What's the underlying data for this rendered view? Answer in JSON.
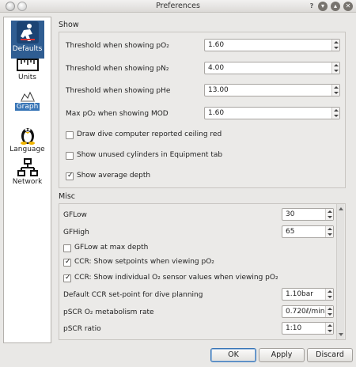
{
  "window": {
    "title": "Preferences"
  },
  "sidebar": {
    "items": [
      {
        "label": "Defaults",
        "icon": "diver-icon"
      },
      {
        "label": "Units",
        "icon": "ruler-icon"
      },
      {
        "label": "Graph",
        "icon": "graph-icon"
      },
      {
        "label": "Language",
        "icon": "penguin-icon"
      },
      {
        "label": "Network",
        "icon": "network-icon"
      }
    ],
    "selected": "Graph"
  },
  "show": {
    "title": "Show",
    "threshold_po2_label": "Threshold when showing pO₂",
    "threshold_po2_value": "1.60",
    "threshold_pn2_label": "Threshold when showing pN₂",
    "threshold_pn2_value": "4.00",
    "threshold_phe_label": "Threshold when showing pHe",
    "threshold_phe_value": "13.00",
    "max_po2_label": "Max pO₂ when showing MOD",
    "max_po2_value": "1.60",
    "draw_ceiling_label": "Draw dive computer reported ceiling red",
    "draw_ceiling_checked": false,
    "show_unused_label": "Show unused cylinders in Equipment tab",
    "show_unused_checked": false,
    "show_avg_depth_label": "Show average depth",
    "show_avg_depth_checked": true
  },
  "misc": {
    "title": "Misc",
    "gflow_label": "GFLow",
    "gflow_value": "30",
    "gfhigh_label": "GFHigh",
    "gfhigh_value": "65",
    "gflow_max_label": "GFLow at max depth",
    "gflow_max_checked": false,
    "ccr_setpoints_label": "CCR: Show setpoints when viewing pO₂",
    "ccr_setpoints_checked": true,
    "ccr_sensor_label": "CCR: Show individual O₂ sensor values when viewing pO₂",
    "ccr_sensor_checked": true,
    "ccr_setpoint_label": "Default CCR set-point for dive planning",
    "ccr_setpoint_value": "1.10bar",
    "pscr_metabolism_label": "pSCR O₂ metabolism rate",
    "pscr_metabolism_value": "0.720ℓ/min",
    "pscr_ratio_label": "pSCR ratio",
    "pscr_ratio_value": "1:10"
  },
  "buttons": {
    "ok": "OK",
    "apply": "Apply",
    "discard": "Discard"
  }
}
